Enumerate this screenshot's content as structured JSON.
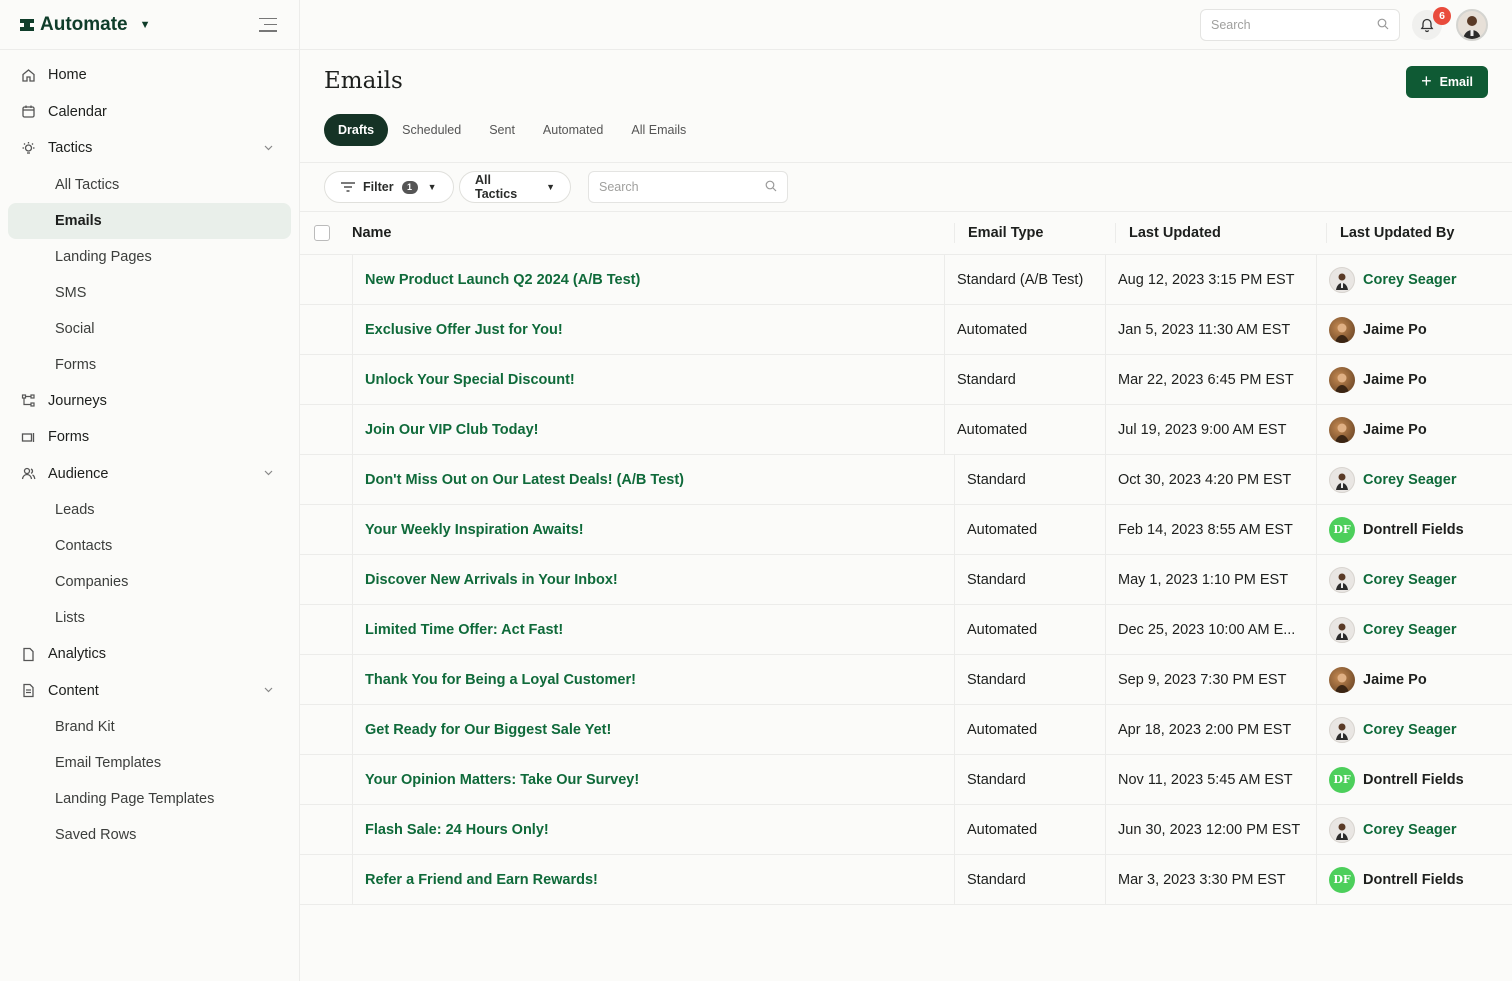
{
  "app": {
    "brand": "Automate"
  },
  "sidebar": {
    "items": [
      {
        "label": "Home",
        "icon": "home-icon"
      },
      {
        "label": "Calendar",
        "icon": "calendar-icon"
      },
      {
        "label": "Tactics",
        "icon": "lightbulb-icon",
        "expanded": true,
        "children": [
          "All Tactics",
          "Emails",
          "Landing Pages",
          "SMS",
          "Social",
          "Forms"
        ]
      },
      {
        "label": "Journeys",
        "icon": "journey-icon"
      },
      {
        "label": "Forms",
        "icon": "form-icon"
      },
      {
        "label": "Audience",
        "icon": "users-icon",
        "expanded": true,
        "children": [
          "Leads",
          "Contacts",
          "Companies",
          "Lists"
        ]
      },
      {
        "label": "Analytics",
        "icon": "file-icon"
      },
      {
        "label": "Content",
        "icon": "document-icon",
        "expanded": true,
        "children": [
          "Brand Kit",
          "Email Templates",
          "Landing Page Templates",
          "Saved Rows"
        ]
      }
    ],
    "active": "Emails"
  },
  "topbar": {
    "search_placeholder": "Search",
    "notification_count": "6"
  },
  "page": {
    "title": "Emails",
    "new_button": "Email",
    "tabs": [
      "Drafts",
      "Scheduled",
      "Sent",
      "Automated",
      "All Emails"
    ],
    "active_tab": "Drafts",
    "filter_label": "Filter",
    "filter_count": "1",
    "tactics_label": "All Tactics",
    "search_placeholder": "Search"
  },
  "table": {
    "columns": [
      "Name",
      "Email Type",
      "Last Updated",
      "Last Updated By"
    ],
    "rows": [
      {
        "name": "New Product Launch Q2 2024 (A/B Test)",
        "type": "Standard (A/B Test)",
        "updated": "Aug 12, 2023 3:15 PM EST",
        "by": "Corey Seager"
      },
      {
        "name": "Exclusive Offer Just for You!",
        "type": "Automated",
        "updated": "Jan 5, 2023 11:30 AM EST",
        "by": "Jaime Po"
      },
      {
        "name": "Unlock Your Special Discount!",
        "type": "Standard",
        "updated": "Mar 22, 2023 6:45 PM EST",
        "by": "Jaime Po"
      },
      {
        "name": "Join Our VIP Club Today!",
        "type": "Automated",
        "updated": "Jul 19, 2023 9:00 AM EST",
        "by": "Jaime Po"
      },
      {
        "name": "Don't Miss Out on Our Latest Deals! (A/B Test)",
        "type": "Standard",
        "updated": "Oct 30, 2023 4:20 PM EST",
        "by": "Corey Seager"
      },
      {
        "name": "Your Weekly Inspiration Awaits!",
        "type": "Automated",
        "updated": "Feb 14, 2023 8:55 AM EST",
        "by": "Dontrell Fields"
      },
      {
        "name": "Discover New Arrivals in Your Inbox!",
        "type": "Standard",
        "updated": "May 1, 2023 1:10 PM EST",
        "by": "Corey Seager"
      },
      {
        "name": "Limited Time Offer: Act Fast!",
        "type": "Automated",
        "updated": "Dec 25, 2023 10:00 AM E...",
        "by": "Corey Seager"
      },
      {
        "name": "Thank You for Being a Loyal Customer!",
        "type": "Standard",
        "updated": "Sep 9, 2023 7:30 PM EST",
        "by": "Jaime Po"
      },
      {
        "name": "Get Ready for Our Biggest Sale Yet!",
        "type": "Automated",
        "updated": "Apr 18, 2023 2:00 PM EST",
        "by": "Corey Seager"
      },
      {
        "name": "Your Opinion Matters: Take Our Survey!",
        "type": "Standard",
        "updated": "Nov 11, 2023 5:45 AM EST",
        "by": "Dontrell Fields"
      },
      {
        "name": "Flash Sale: 24 Hours Only!",
        "type": "Automated",
        "updated": "Jun 30, 2023 12:00 PM EST",
        "by": "Corey Seager"
      },
      {
        "name": "Refer a Friend and Earn Rewards!",
        "type": "Standard",
        "updated": "Mar 3, 2023 3:30 PM EST",
        "by": "Dontrell Fields"
      }
    ],
    "avatar_initials": {
      "Dontrell Fields": "DF"
    }
  },
  "colors": {
    "brand": "#0f3d2a",
    "accent": "#0f5a34",
    "link": "#0f6a3a",
    "badge": "#e94b3c"
  }
}
